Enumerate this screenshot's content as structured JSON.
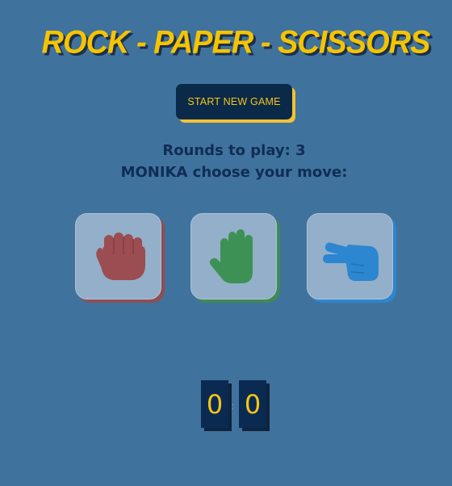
{
  "title": "ROCK - PAPER - SCISSORS",
  "start_button": "START NEW GAME",
  "rounds_text": "Rounds to play: 3",
  "prompt_text": "MONIKA choose your move:",
  "moves": [
    {
      "name": "rock",
      "icon": "fist-icon",
      "color": "#9c4d51",
      "shadow": "#8f4e52"
    },
    {
      "name": "paper",
      "icon": "open-hand-icon",
      "color": "#3d9155",
      "shadow": "#3f8a56"
    },
    {
      "name": "scissors",
      "icon": "two-fingers-icon",
      "color": "#2c86d0",
      "shadow": "#2e86cd"
    }
  ],
  "score": {
    "player": "0",
    "separator": ":",
    "computer": "0"
  },
  "colors": {
    "background": "#40729e",
    "accent": "#f5c518",
    "navy": "#0b2a4a",
    "text": "#0f2d55"
  }
}
